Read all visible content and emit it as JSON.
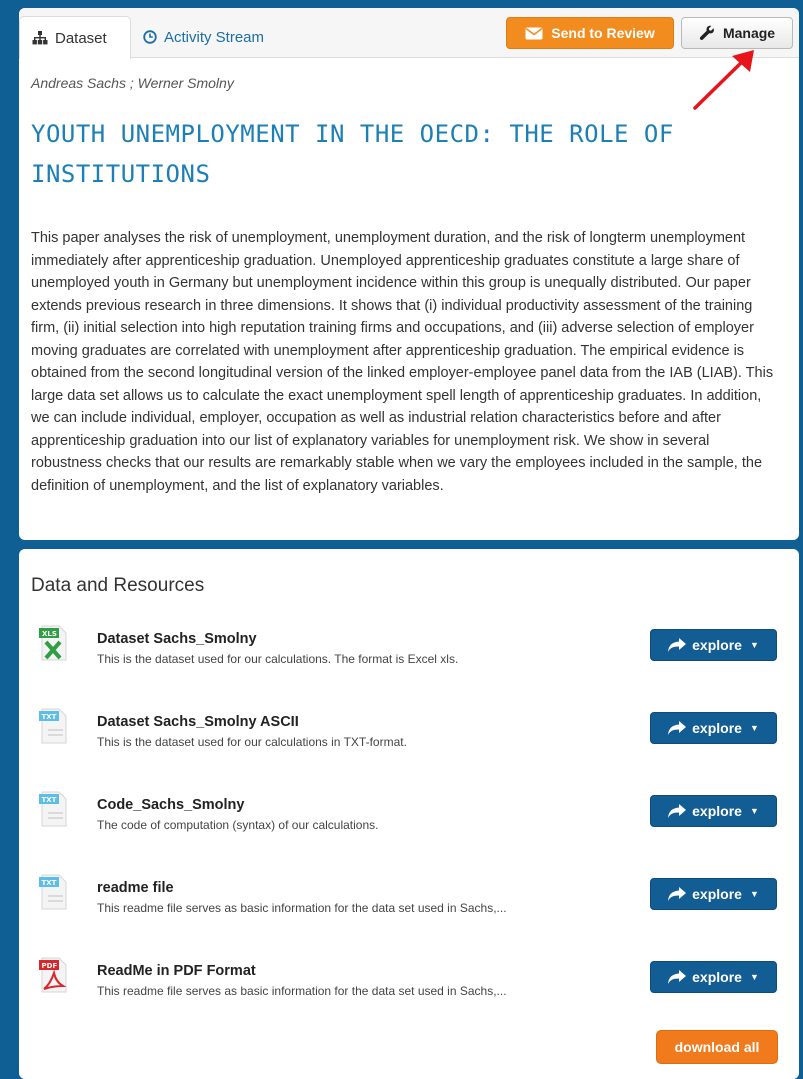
{
  "tabs": {
    "dataset_label": "Dataset",
    "activity_label": "Activity Stream"
  },
  "actions": {
    "send_to_review_label": "Send to Review",
    "manage_label": "Manage"
  },
  "dataset": {
    "authors": "Andreas Sachs ; Werner Smolny",
    "title": "YOUTH UNEMPLOYMENT IN THE OECD: THE ROLE OF INSTITUTIONS",
    "abstract": "This paper analyses the risk of unemployment, unemployment duration, and the risk of longterm unemployment immediately after apprenticeship graduation. Unemployed apprenticeship graduates constitute a large share of unemployed youth in Germany but unemployment incidence within this group is unequally distributed. Our paper extends previous research in three dimensions. It shows that (i) individual productivity assessment of the training firm, (ii) initial selection into high reputation training firms and occupations, and (iii) adverse selection of employer moving graduates are correlated with unemployment after apprenticeship graduation. The empirical evidence is obtained from the second longitudinal version of the linked employer-employee panel data from the IAB (LIAB). This large data set allows us to calculate the exact unemployment spell length of apprenticeship graduates. In addition, we can include individual, employer, occupation as well as industrial relation characteristics before and after apprenticeship graduation into our list of explanatory variables for unemployment risk. We show in several robustness checks that our results are remarkably stable when we vary the employees included in the sample, the definition of unemployment, and the list of explanatory variables."
  },
  "resources": {
    "heading": "Data and Resources",
    "explore_label": "explore",
    "download_all_label": "download all",
    "items": [
      {
        "format": "XLS",
        "icon": "excel-file-icon",
        "title": "Dataset Sachs_Smolny",
        "description": "This is the dataset used for our calculations. The format is Excel xls."
      },
      {
        "format": "TXT",
        "icon": "text-file-icon",
        "title": "Dataset Sachs_Smolny ASCII",
        "description": "This is the dataset used for our calculations in TXT-format."
      },
      {
        "format": "TXT",
        "icon": "text-file-icon",
        "title": "Code_Sachs_Smolny",
        "description": "The code of computation (syntax) of our calculations."
      },
      {
        "format": "TXT",
        "icon": "text-file-icon",
        "title": "readme file",
        "description": "This readme file serves as basic information for the data set used in Sachs,..."
      },
      {
        "format": "PDF",
        "icon": "pdf-file-icon",
        "title": "ReadMe in PDF Format",
        "description": "This readme file serves as basic information for the data set used in Sachs,..."
      }
    ]
  },
  "colors": {
    "page_background": "#0f5f94",
    "title": "#1c7fb6",
    "review_button": "#f28c1e",
    "explore_button": "#135d95",
    "download_button": "#f07a1c",
    "annotation_arrow": "#e8141c"
  }
}
